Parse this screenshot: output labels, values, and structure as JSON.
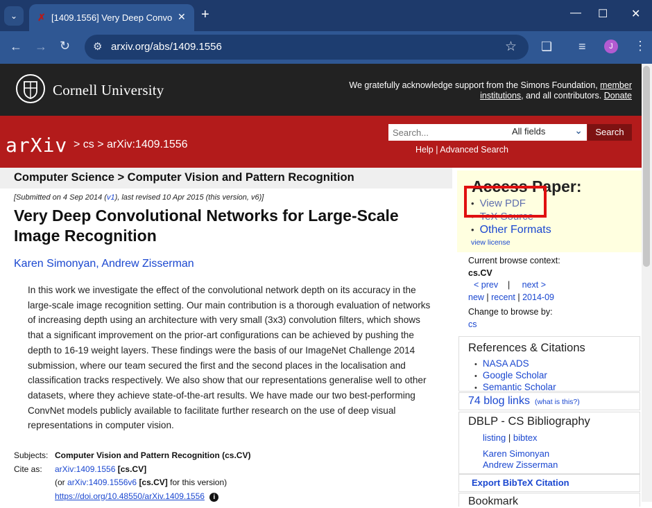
{
  "browser": {
    "tab_title": "[1409.1556] Very Deep Convolu",
    "url": "arxiv.org/abs/1409.1556",
    "profile_initial": "J"
  },
  "cornell": {
    "name": "Cornell University",
    "ack_text": "We gratefully acknowledge support from the Simons Foundation,",
    "ack_link1": "member institutions",
    "ack_mid": ", and all contributors.",
    "ack_link2": "Donate"
  },
  "arxiv_header": {
    "logo": "arXiv",
    "breadcrumb": "> cs > arXiv:1409.1556",
    "search_placeholder": "Search...",
    "field_select": "All fields",
    "search_button": "Search",
    "help": "Help",
    "advanced": "Advanced Search"
  },
  "paper": {
    "subheading": "Computer Science > Computer Vision and Pattern Recognition",
    "dateline_pre": "[Submitted on 4 Sep 2014 (",
    "dateline_v1": "v1",
    "dateline_post": "), last revised 10 Apr 2015 (this version, v6)]",
    "title": "Very Deep Convolutional Networks for Large-Scale Image Recognition",
    "author1": "Karen Simonyan",
    "author2": "Andrew Zisserman",
    "abstract": "In this work we investigate the effect of the convolutional network depth on its accuracy in the large-scale image recognition setting. Our main contribution is a thorough evaluation of networks of increasing depth using an architecture with very small (3x3) convolution filters, which shows that a significant improvement on the prior-art configurations can be achieved by pushing the depth to 16-19 weight layers. These findings were the basis of our ImageNet Challenge 2014 submission, where our team secured the first and the second places in the localisation and classification tracks respectively. We also show that our representations generalise well to other datasets, where they achieve state-of-the-art results. We have made our two best-performing ConvNet models publicly available to facilitate further research on the use of deep visual representations in computer vision.",
    "subjects_label": "Subjects:",
    "subjects_value": "Computer Vision and Pattern Recognition (cs.CV)",
    "cite_label": "Cite as:",
    "cite_link": "arXiv:1409.1556",
    "cite_tag": "[cs.CV]",
    "or_pre": "(or",
    "or_link": "arXiv:1409.1556v6",
    "or_tag": "[cs.CV]",
    "or_post": "for this version)",
    "doi": "https://doi.org/10.48550/arXiv.1409.1556"
  },
  "sidebar": {
    "access_heading": "Access Paper:",
    "access_items": [
      "View PDF",
      "TeX Source",
      "Other Formats"
    ],
    "view_license": "view license",
    "ctx_label": "Current browse context:",
    "ctx_value": "cs.CV",
    "prev": "< prev",
    "sep": "|",
    "next": "next >",
    "new": "new",
    "recent": "recent",
    "month": "2014-09",
    "change_label": "Change to browse by:",
    "change_value": "cs",
    "refs_heading": "References & Citations",
    "refs": [
      "NASA ADS",
      "Google Scholar",
      "Semantic Scholar"
    ],
    "blog_links": "74 blog links",
    "blog_what": "(what is this?)",
    "dblp_heading": "DBLP - CS Bibliography",
    "dblp_listing": "listing",
    "dblp_bibtex": "bibtex",
    "dblp_authors": [
      "Karen Simonyan",
      "Andrew Zisserman"
    ],
    "export": "Export BibTeX Citation",
    "bookmark": "Bookmark"
  }
}
